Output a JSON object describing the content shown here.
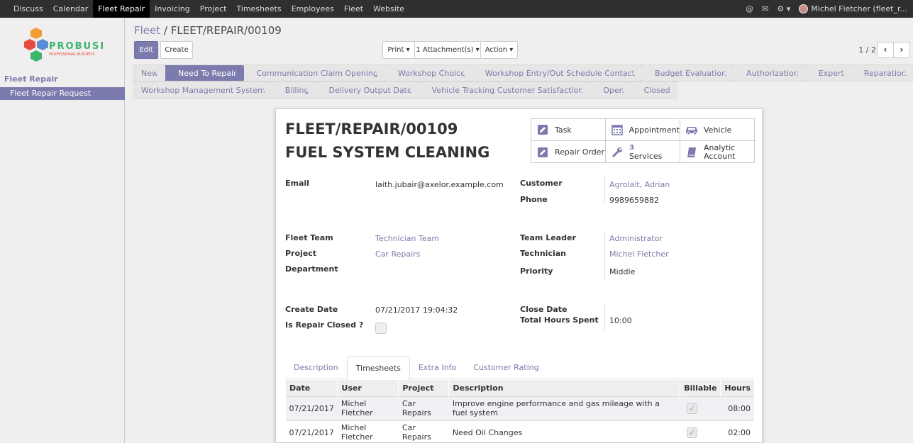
{
  "topnav": {
    "menu": [
      "Discuss",
      "Calendar",
      "Fleet Repair",
      "Invoicing",
      "Project",
      "Timesheets",
      "Employees",
      "Fleet",
      "Website"
    ],
    "active": "Fleet Repair",
    "user": "Michel Fletcher (fleet_r..."
  },
  "sidebar": {
    "logo_text": "PROBUSE",
    "logo_sub": "PROFESSIONAL BUSINESS",
    "section": "Fleet Repair",
    "item": "Fleet Repair Request"
  },
  "breadcrumb": {
    "parent": "Fleet",
    "sep": "/",
    "current": "FLEET/REPAIR/00109"
  },
  "buttons": {
    "edit": "Edit",
    "create": "Create",
    "print": "Print",
    "attachments": "1 Attachment(s)",
    "action": "Action"
  },
  "pager": {
    "value": "1 / 2",
    "prev": "‹",
    "next": "›"
  },
  "stages_row1": [
    "New",
    "Need To Repair",
    "Communication Claim Opening",
    "Workshop Choice",
    "Workshop Entry/Out Schedule Contact",
    "Budget Evaluation",
    "Authorization",
    "Expert",
    "Reparation"
  ],
  "stages_row2": [
    "Workshop Management System",
    "Billing",
    "Delivery Output Date",
    "Vehicle Tracking Customer Satisfaction",
    "Open",
    "Closed"
  ],
  "current_stage": "Need To Repair",
  "record": {
    "name": "FLEET/REPAIR/00109",
    "subject": "FUEL SYSTEM CLEANING"
  },
  "smart_buttons": {
    "task": "Task",
    "appointment": "Appointment",
    "vehicle": "Vehicle",
    "repair_order": "Repair Order",
    "services_count": "3",
    "services": "Services",
    "analytic1": "Analytic",
    "analytic2": "Account"
  },
  "fields": {
    "email_label": "Email",
    "email": "laith.jubair@axelor.example.com",
    "customer_label": "Customer",
    "customer": "Agrolait, Adrian",
    "phone_label": "Phone",
    "phone": "9989659882",
    "fleet_team_label": "Fleet Team",
    "fleet_team": "Technician Team",
    "project_label": "Project",
    "project": "Car Repairs",
    "department_label": "Department",
    "team_leader_label": "Team Leader",
    "team_leader": "Administrator",
    "technician_label": "Technician",
    "technician": "Michel Fletcher",
    "priority_label": "Priority",
    "priority": "Middle",
    "create_date_label": "Create Date",
    "create_date": "07/21/2017 19:04:32",
    "repair_closed_label": "Is Repair Closed ?",
    "close_date_label": "Close Date",
    "hours_label": "Total Hours Spent",
    "hours": "10:00"
  },
  "tabs": [
    "Description",
    "Timesheets",
    "Extra Info",
    "Customer Rating"
  ],
  "active_tab": "Timesheets",
  "timesheet": {
    "headers": [
      "Date",
      "User",
      "Project",
      "Description",
      "Billable",
      "Hours"
    ],
    "rows": [
      [
        "07/21/2017",
        "Michel Fletcher",
        "Car Repairs",
        "Improve engine performance and gas mileage with a fuel system",
        "08:00"
      ],
      [
        "07/21/2017",
        "Michel Fletcher",
        "Car Repairs",
        "Need Oil Changes",
        "02:00"
      ]
    ]
  },
  "colors": {
    "accent": "#7c7bad",
    "topbar": "#2f2f2f"
  }
}
